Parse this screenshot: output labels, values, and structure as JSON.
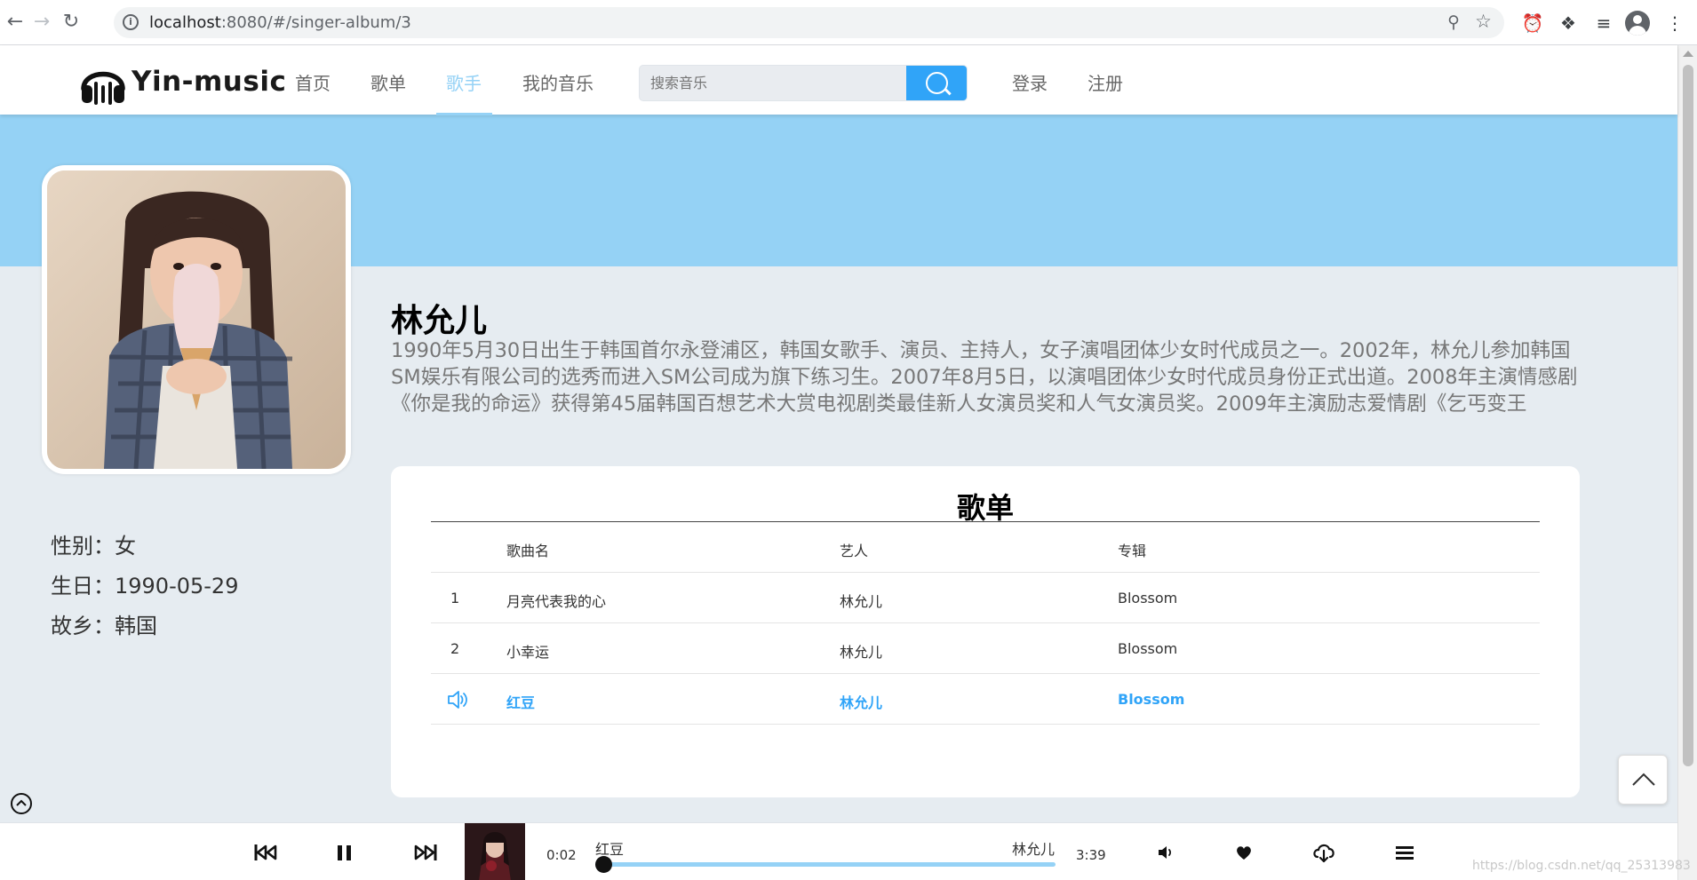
{
  "browser": {
    "url_host": "localhost",
    "url_path": ":8080/#/singer-album/3"
  },
  "header": {
    "logo_text": "Yin-music",
    "nav": [
      "首页",
      "歌单",
      "歌手",
      "我的音乐"
    ],
    "active_nav": "歌手",
    "search_placeholder": "搜索音乐",
    "login_label": "登录",
    "register_label": "注册"
  },
  "singer": {
    "name": "林允儿",
    "description": "1990年5月30日出生于韩国首尔永登浦区，韩国女歌手、演员、主持人，女子演唱团体少女时代成员之一。2002年，林允儿参加韩国SM娱乐有限公司的选秀而进入SM公司成为旗下练习生。2007年8月5日，以演唱团体少女时代成员身份正式出道。2008年主演情感剧《你是我的命运》获得第45届韩国百想艺术大赏电视剧类最佳新人女演员奖和人气女演员奖。2009年主演励志爱情剧《乞丐变王子》...",
    "gender": "性别：女",
    "birthday": "生日：1990-05-29",
    "hometown": "故乡：韩国"
  },
  "songlist": {
    "title": "歌单",
    "headers": {
      "name": "歌曲名",
      "artist": "艺人",
      "album": "专辑"
    },
    "rows": [
      {
        "index": "1",
        "name": "月亮代表我的心",
        "artist": "林允儿",
        "album": "Blossom",
        "playing": false
      },
      {
        "index": "2",
        "name": "小幸运",
        "artist": "林允儿",
        "album": "Blossom",
        "playing": false
      },
      {
        "index": "",
        "name": "红豆",
        "artist": "林允儿",
        "album": "Blossom",
        "playing": true
      }
    ]
  },
  "player": {
    "current_time": "0:02",
    "total_time": "3:39",
    "title": "红豆",
    "artist": "林允儿",
    "progress": 0.01,
    "watermark": "https://blog.csdn.net/qq_25313983"
  },
  "colors": {
    "accent": "#30a4f8",
    "banner": "#95d2f5",
    "background": "#e6ecf1"
  }
}
